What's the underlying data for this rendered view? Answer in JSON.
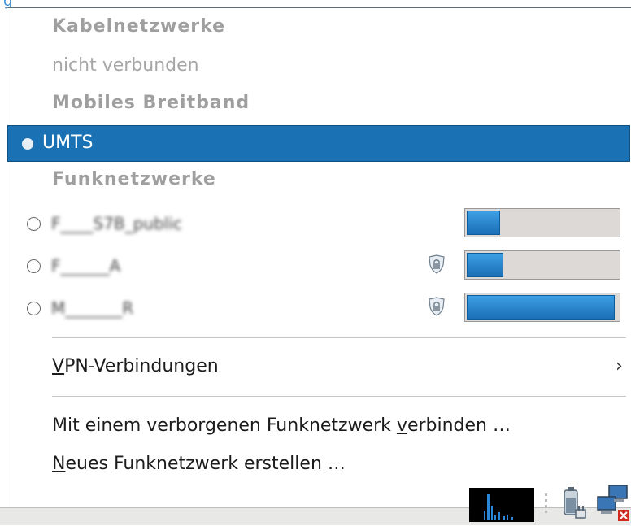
{
  "header": {
    "link_fragment": "g"
  },
  "menu": {
    "wired_section": "Kabelnetzwerke",
    "wired_status": "nicht verbunden",
    "mobile_section": "Mobiles Breitband",
    "mobile_connection": "UMTS",
    "wireless_section": "Funknetzwerke",
    "wireless_networks": [
      {
        "ssid": "F____S7B_public",
        "secured": false,
        "signal": 0.22
      },
      {
        "ssid": "F______A",
        "secured": true,
        "signal": 0.24
      },
      {
        "ssid": "M_______R",
        "secured": true,
        "signal": 0.98
      }
    ],
    "vpn": {
      "mnemonic": "V",
      "label_rest": "PN-Verbindungen",
      "arrow": "›"
    },
    "hidden_network": {
      "prefix": "Mit einem verborgenen Funknetzwerk ",
      "mnemonic": "v",
      "suffix": "erbinden …"
    },
    "new_network": {
      "mnemonic": "N",
      "label_rest": "eues Funknetzwerk erstellen …"
    }
  },
  "colors": {
    "selection": "#1a72b4",
    "section_text": "#9f9f9f",
    "signal_fill": "#2585d0"
  },
  "icons": [
    "shield-lock-icon",
    "system-monitor-icon",
    "battery-plug-icon",
    "network-disconnected-icon"
  ]
}
